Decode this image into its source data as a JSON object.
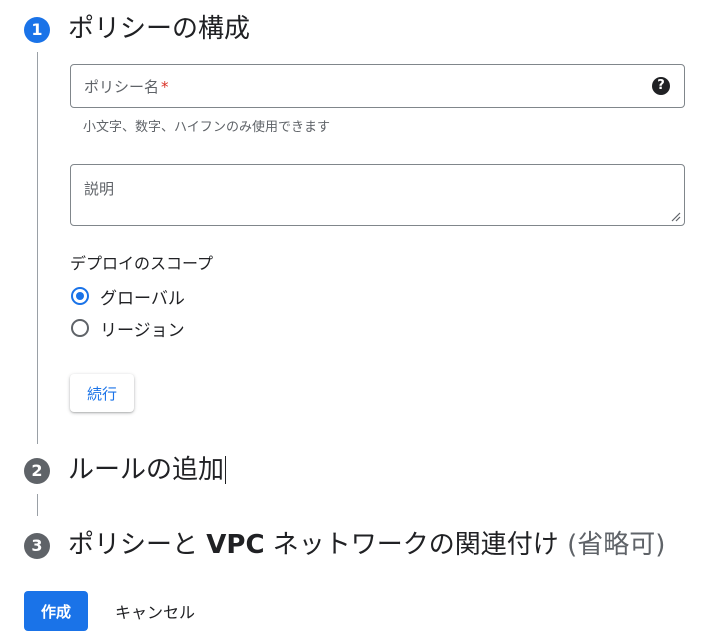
{
  "steps": [
    {
      "number": "1",
      "title": "ポリシーの構成",
      "state": "active"
    },
    {
      "number": "2",
      "title": "ルールの追加",
      "state": "inactive"
    },
    {
      "number": "3",
      "title_pre": "ポリシーと ",
      "title_bold": "VPC",
      "title_post": " ネットワークの関連付け ",
      "title_optional": "(省略可)",
      "state": "inactive"
    }
  ],
  "form": {
    "policy_name": {
      "label": "ポリシー名",
      "required_mark": "*",
      "value": "",
      "help_icon": "question-circle-icon",
      "hint": "小文字、数字、ハイフンのみ使用できます"
    },
    "description": {
      "label": "説明",
      "value": ""
    },
    "deploy_scope": {
      "label": "デプロイのスコープ",
      "options": [
        {
          "label": "グローバル",
          "selected": true
        },
        {
          "label": "リージョン",
          "selected": false
        }
      ]
    },
    "continue_label": "続行"
  },
  "actions": {
    "create_label": "作成",
    "cancel_label": "キャンセル"
  },
  "colors": {
    "accent": "#1a73e8",
    "inactive": "#5f6368",
    "required": "#d93025"
  }
}
